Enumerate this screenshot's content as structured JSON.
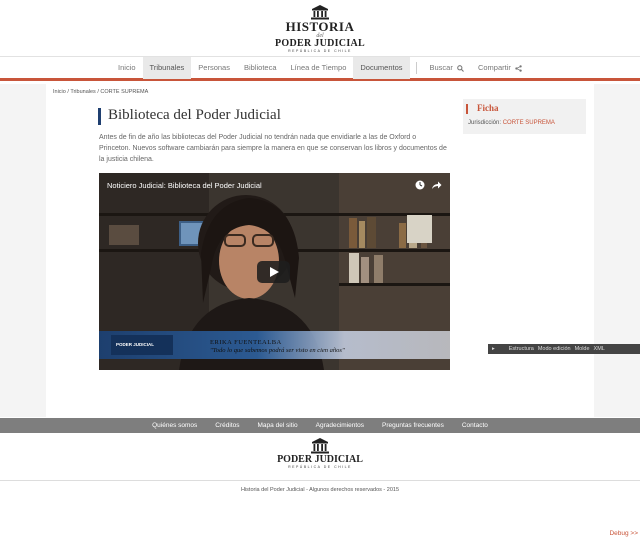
{
  "logo": {
    "line1": "HISTORIA",
    "line2": "del",
    "line3": "PODER JUDICIAL",
    "line4": "REPÚBLICA DE CHILE"
  },
  "nav": {
    "items": [
      "Inicio",
      "Tribunales",
      "Personas",
      "Biblioteca",
      "Línea de Tiempo",
      "Documentos"
    ],
    "search": "Buscar",
    "share": "Compartir"
  },
  "breadcrumb": "Inicio / Tribunales / CORTE SUPREMA",
  "article": {
    "title": "Biblioteca del Poder Judicial",
    "description": "Antes de fin de año las bibliotecas del Poder Judicial no tendrán nada que envidiarle a las de Oxford o Princeton. Nuevos software cambiarán para siempre la manera en que se conservan los libros y documentos de la justicia chilena."
  },
  "video": {
    "title": "Noticiero Judicial: Biblioteca del Poder Judicial",
    "badge": "PODER JUDICIAL",
    "lower_name": "ERIKA FUENTEALBA",
    "lower_quote": "\"Todo lo que sabemos podrá ser visto en cien años\""
  },
  "ficha": {
    "heading": "Ficha",
    "label": "Jurisdicción:",
    "value": "CORTE SUPREMA"
  },
  "toolbar": {
    "items": [
      "Estructura",
      "Modo edición",
      "Molde",
      "XML"
    ]
  },
  "footer": {
    "links": [
      "Quiénes somos",
      "Créditos",
      "Mapa del sitio",
      "Agradecimientos",
      "Preguntas frecuentes",
      "Contacto"
    ],
    "logo_line1": "PODER JUDICIAL",
    "logo_line2": "REPÚBLICA DE CHILE",
    "copyright": "Historia del Poder Judicial - Algunos derechos reservados - 2015",
    "debug": "Debug >>"
  },
  "colors": {
    "accent": "#c8553a",
    "title_bar": "#1f3f70",
    "footer_bar": "#7e7e7e"
  }
}
